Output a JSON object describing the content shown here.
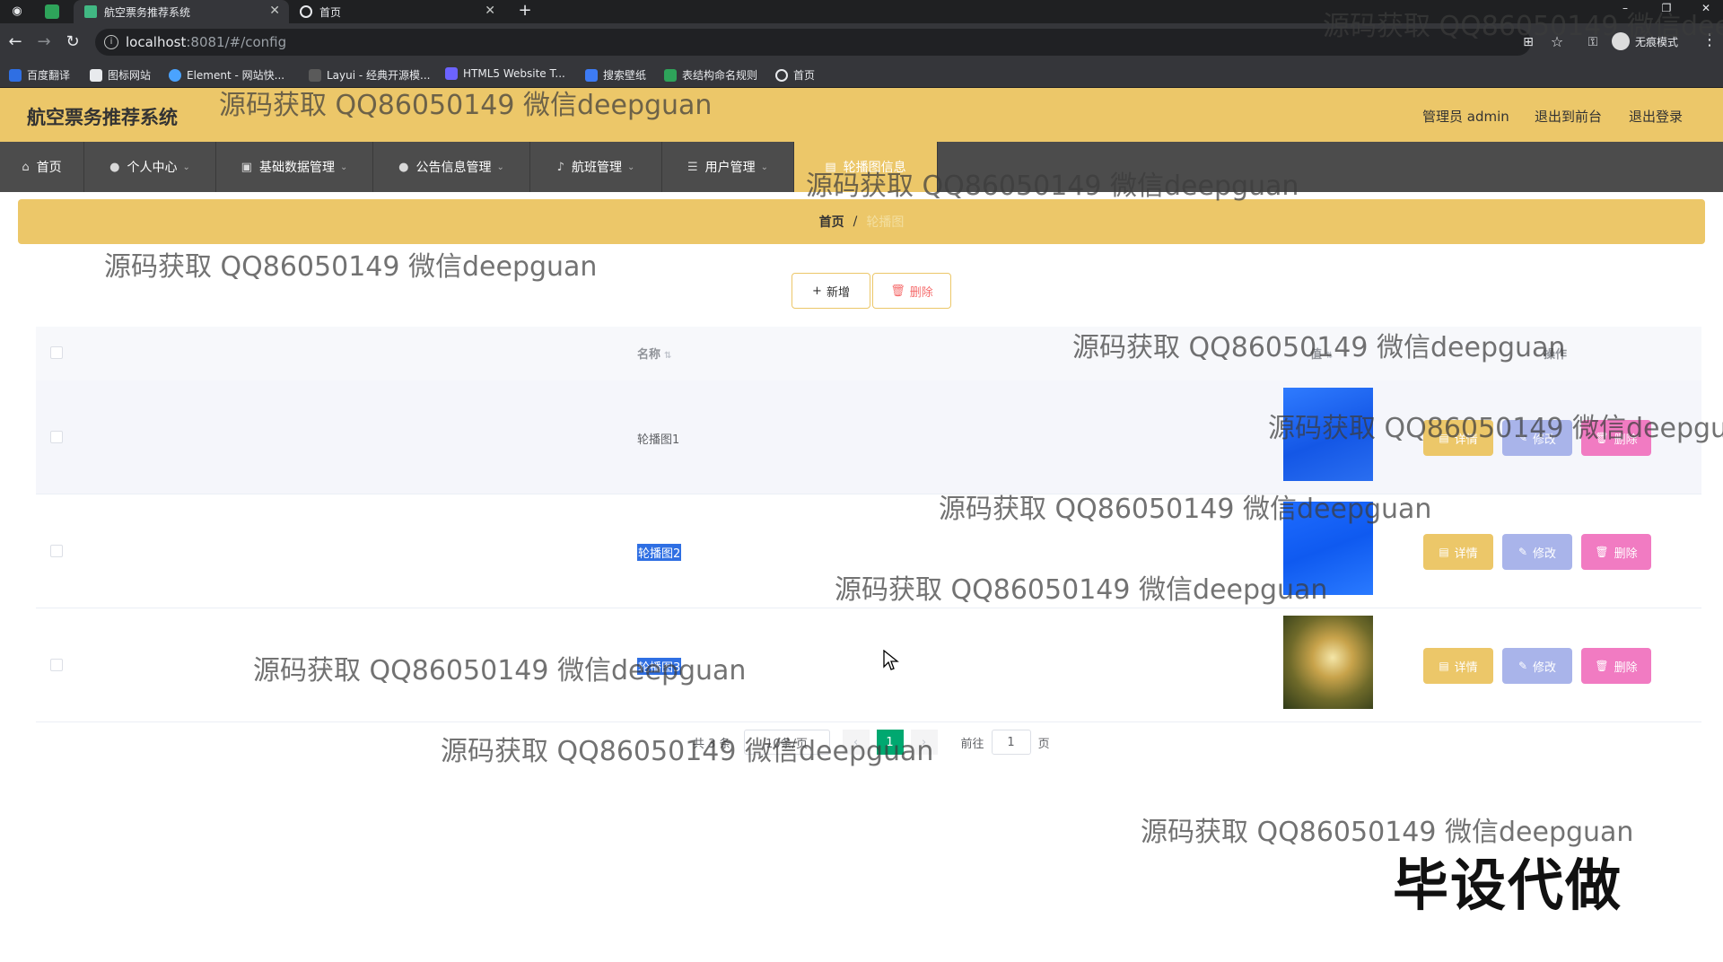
{
  "browser": {
    "tabs": [
      {
        "label": "航空票务推荐系统",
        "active": true
      },
      {
        "label": "首页",
        "active": false
      }
    ],
    "url_host": "localhost",
    "url_rest": ":8081/#/config",
    "profile_label": "无痕模式",
    "bookmarks": [
      "百度翻译",
      "图标网站",
      "Element - 网站快...",
      "Layui - 经典开源模...",
      "HTML5 Website T...",
      "搜索壁纸",
      "表结构命名规则",
      "首页"
    ]
  },
  "header": {
    "title": "航空票务推荐系统",
    "admin_label": "管理员 admin",
    "back_to_front": "退出到前台",
    "logout": "退出登录"
  },
  "nav": [
    {
      "label": "首页",
      "icon": "home-icon"
    },
    {
      "label": "个人中心",
      "icon": "user-icon"
    },
    {
      "label": "基础数据管理",
      "icon": "database-icon"
    },
    {
      "label": "公告信息管理",
      "icon": "user-icon"
    },
    {
      "label": "航班管理",
      "icon": "mic-icon"
    },
    {
      "label": "用户管理",
      "icon": "list-icon"
    },
    {
      "label": "轮播图信息",
      "icon": "picture-icon"
    }
  ],
  "breadcrumb": {
    "home": "首页",
    "separator": "/",
    "current": "轮播图"
  },
  "toolbar": {
    "add_label": "新增",
    "delete_label": "删除"
  },
  "table": {
    "headers": {
      "name": "名称",
      "value": "值",
      "action": "操作"
    },
    "rows": [
      {
        "name": "轮播图1",
        "image": "blue1"
      },
      {
        "name": "轮播图2",
        "image": "blue2"
      },
      {
        "name": "轮播图3",
        "image": "photo"
      }
    ],
    "actions": {
      "detail": "详情",
      "edit": "修改",
      "delete": "删除"
    }
  },
  "pagination": {
    "total": "共 3 条",
    "page_size": "10条/页",
    "current_page": "1",
    "goto_prefix": "前往",
    "goto_value": "1",
    "goto_suffix": "页"
  },
  "watermark": {
    "text": "源码获取 QQ86050149 微信deepguan",
    "badge": "毕设代做"
  },
  "colors": {
    "accent": "#ecc769",
    "nav_bg": "#4c4c4c",
    "detail_btn": "#ecc769",
    "edit_btn": "#a9b4ea",
    "delete_btn": "#f17bc2",
    "page_active": "#00a870"
  }
}
